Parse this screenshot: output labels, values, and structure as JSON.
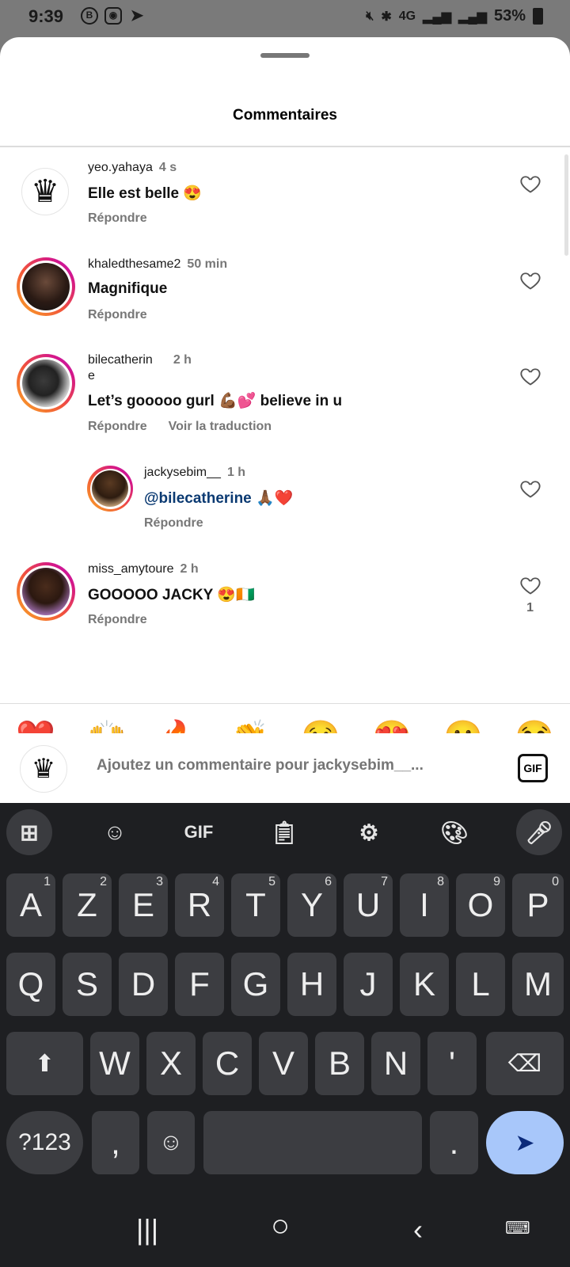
{
  "status_bar": {
    "time": "9:39",
    "battery": "53%",
    "network": "4G",
    "left_icons": [
      "b-circle-icon",
      "instagram-icon",
      "telegram-icon"
    ],
    "right_icons": [
      "mute-icon",
      "bluetooth-icon",
      "signal-icon",
      "battery-icon"
    ]
  },
  "sheet": {
    "title": "Commentaires"
  },
  "comments": [
    {
      "user": "yeo.yahaya",
      "time": "4 s",
      "text": "Elle est belle 😍",
      "reply": "Répondre",
      "likes": ""
    },
    {
      "user": "khaledthesame2",
      "time": "50 min",
      "text": "Magnifique",
      "reply": "Répondre",
      "likes": ""
    },
    {
      "user_line1": "bilecatherin",
      "user_line2": "e",
      "time": "2 h",
      "text": "Let’s gooooo gurl 💪🏾💕 believe in u",
      "reply": "Répondre",
      "translate": "Voir la traduction",
      "likes": ""
    },
    {
      "user": "jackysebim__",
      "time": "1 h",
      "mention": "@bilecatherine",
      "text": " 🙏🏾❤️",
      "reply": "Répondre",
      "likes": ""
    },
    {
      "user": "miss_amytoure",
      "time": "2 h",
      "text": "GOOOOO JACKY 😍🇨🇮",
      "reply": "Répondre",
      "likes": "1"
    }
  ],
  "reactions": [
    "❤️",
    "🙌",
    "🔥",
    "👏",
    "😢",
    "😍",
    "😮",
    "😂"
  ],
  "composer": {
    "placeholder": "Ajoutez un commentaire pour jackysebim__...",
    "gif_label": "GIF"
  },
  "keyboard": {
    "toolbar": {
      "gif": "GIF"
    },
    "row1": [
      [
        "A",
        "1"
      ],
      [
        "Z",
        "2"
      ],
      [
        "E",
        "3"
      ],
      [
        "R",
        "4"
      ],
      [
        "T",
        "5"
      ],
      [
        "Y",
        "6"
      ],
      [
        "U",
        "7"
      ],
      [
        "I",
        "8"
      ],
      [
        "O",
        "9"
      ],
      [
        "P",
        "0"
      ]
    ],
    "row2": [
      "Q",
      "S",
      "D",
      "F",
      "G",
      "H",
      "J",
      "K",
      "L",
      "M"
    ],
    "row3": [
      "W",
      "X",
      "C",
      "V",
      "B",
      "N",
      "'"
    ],
    "symbols": "?123",
    "comma": ",",
    "period": "."
  },
  "colors": {
    "accent": "#a8c7fa",
    "mention": "#0b3a72",
    "keyboard_bg": "#1e1f22",
    "key_bg": "#3c3d41"
  }
}
